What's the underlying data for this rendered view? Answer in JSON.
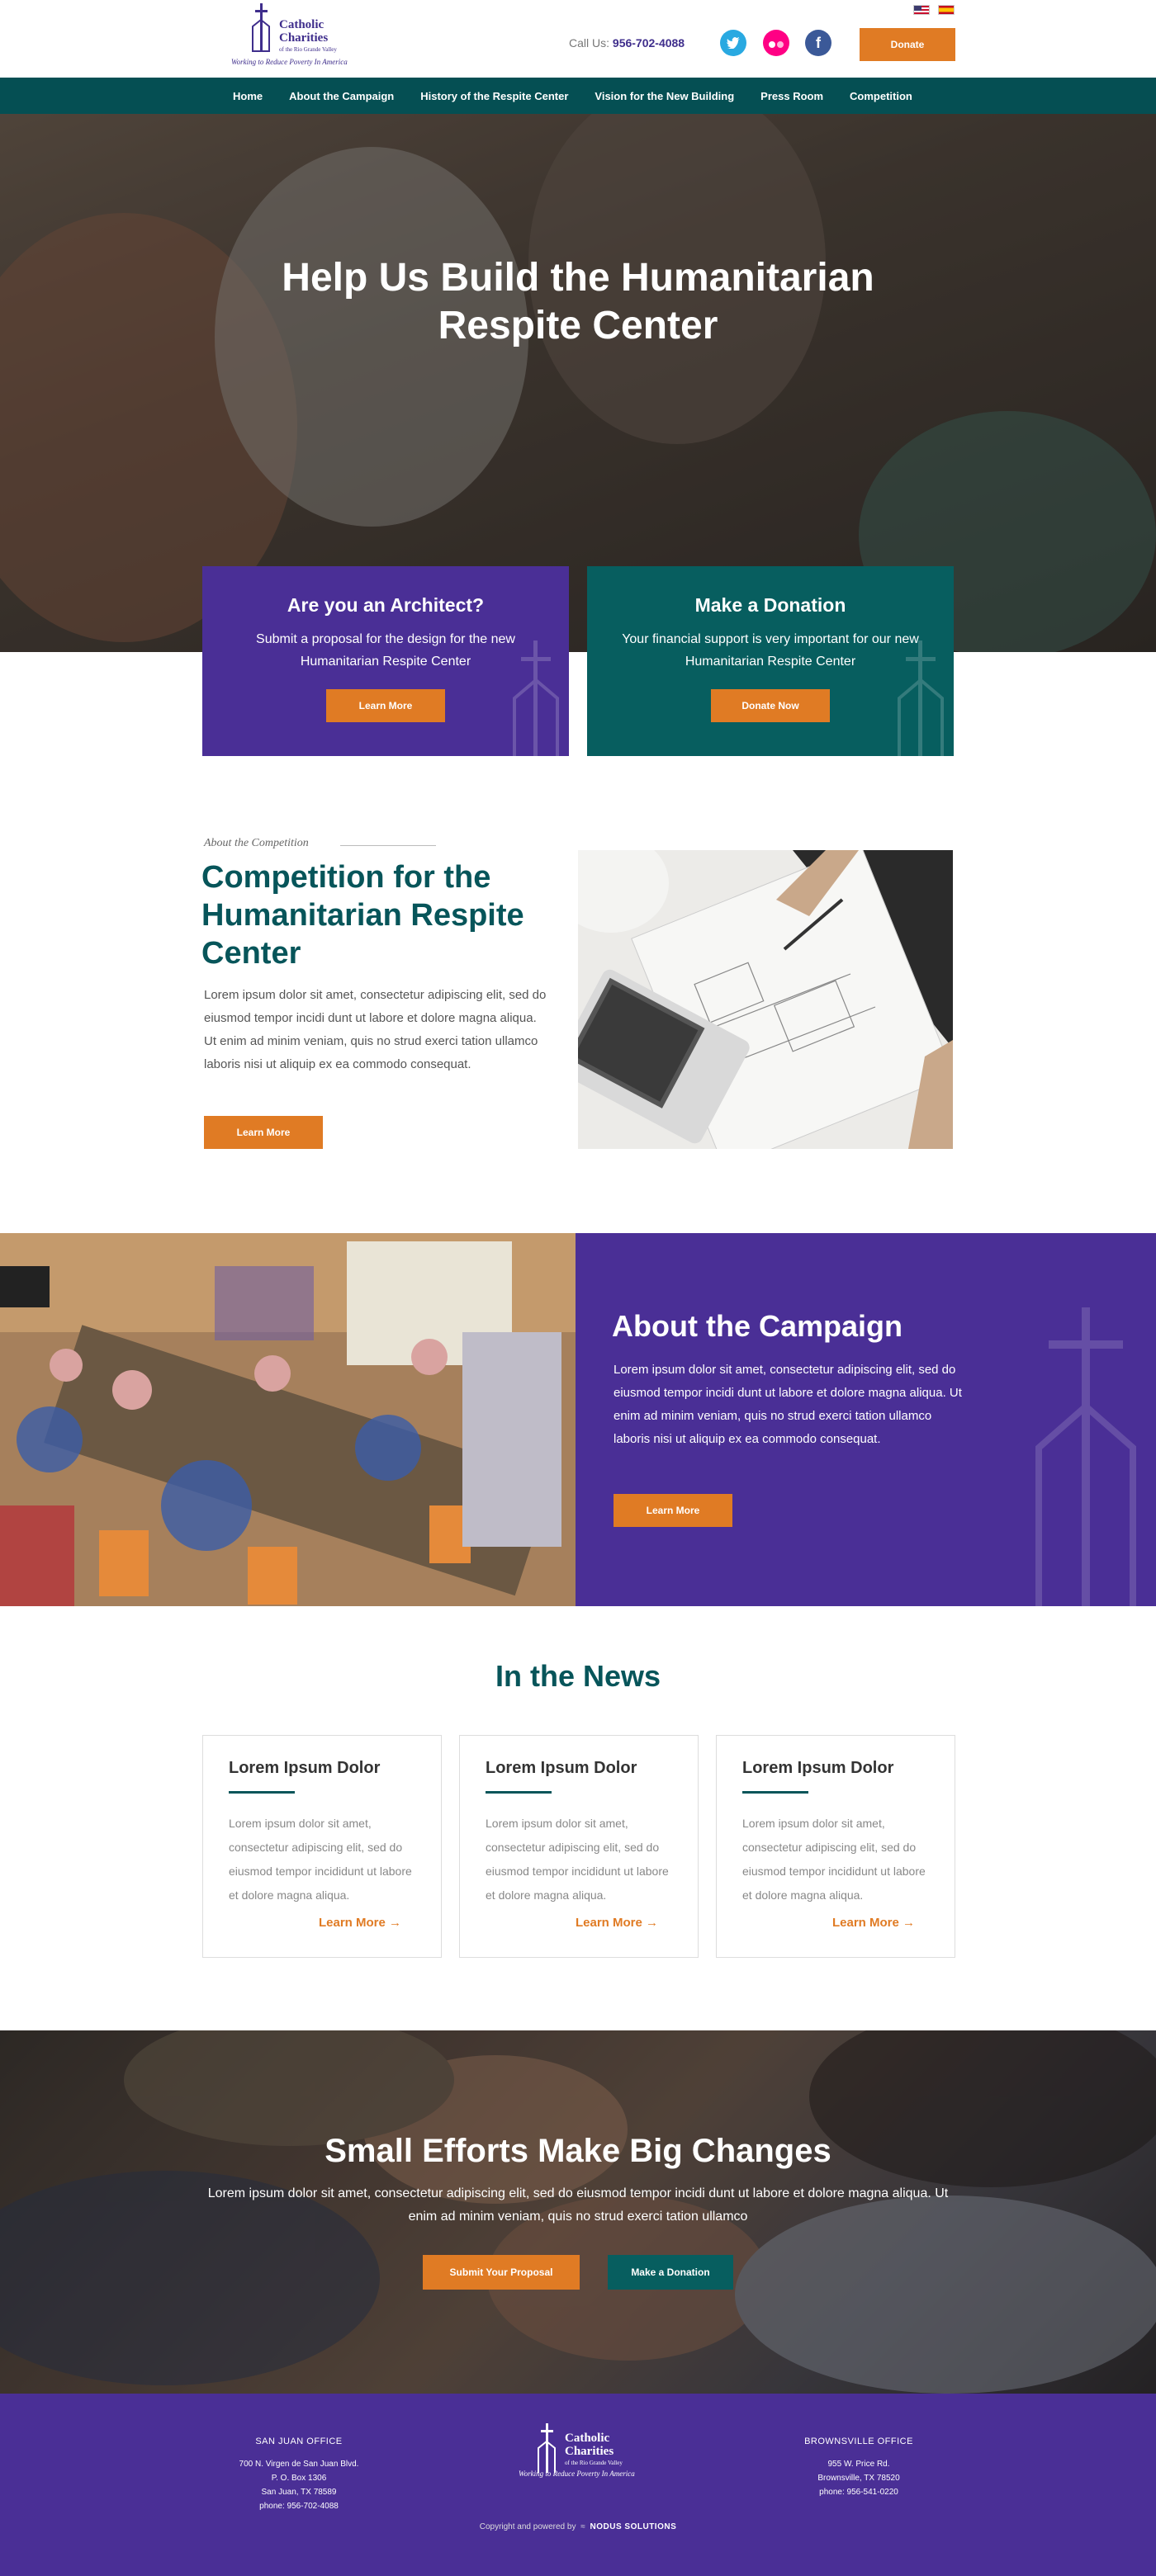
{
  "header": {
    "logo": {
      "line1": "Catholic",
      "line2": "Charities",
      "subtitle": "of the Rio Grande Valley",
      "tagline": "Working to Reduce Poverty In America"
    },
    "call_label": "Call Us:",
    "phone": "956-702-4088",
    "social": [
      {
        "icon": "twitter-icon"
      },
      {
        "icon": "flickr-icon"
      },
      {
        "icon": "facebook-icon"
      }
    ],
    "languages": [
      "us-flag-icon",
      "spain-flag-icon"
    ],
    "donate_label": "Donate"
  },
  "nav": {
    "items": [
      "Home",
      "About  the Campaign",
      "History of the Respite Center",
      "Vision for the New Building",
      "Press Room",
      "Competition"
    ]
  },
  "hero": {
    "title_line1": "Help Us Build the Humanitarian",
    "title_line2": "Respite Center",
    "cards": [
      {
        "title": "Are you an Architect?",
        "text": "Submit a proposal for the design for the new Humanitarian Respite Center",
        "button": "Learn More"
      },
      {
        "title": "Make a Donation",
        "text": "Your financial support is very important for our new Humanitarian Respite Center",
        "button": "Donate Now"
      }
    ]
  },
  "competition": {
    "eyebrow": "About the Competition",
    "title": "Competition for the Humanitarian Respite Center",
    "text": "Lorem ipsum dolor sit amet, consectetur adipiscing elit, sed do eiusmod tempor incidi dunt ut labore et dolore magna aliqua. Ut enim ad minim veniam, quis no strud exerci tation ullamco laboris nisi ut aliquip ex ea commodo consequat.",
    "button": "Learn More"
  },
  "campaign": {
    "title": "About the Campaign",
    "text": "Lorem ipsum dolor sit amet, consectetur adipiscing elit, sed do eiusmod tempor incidi dunt ut labore et dolore magna aliqua. Ut enim ad minim veniam, quis no strud exerci tation ullamco laboris nisi ut aliquip ex ea commodo consequat.",
    "button": "Learn More"
  },
  "news": {
    "title": "In the News",
    "items": [
      {
        "title": "Lorem Ipsum Dolor",
        "text": "Lorem ipsum dolor sit amet, consectetur adipiscing elit, sed do eiusmod tempor incididunt ut labore et dolore magna aliqua.",
        "link": "Learn More"
      },
      {
        "title": "Lorem Ipsum Dolor",
        "text": "Lorem ipsum dolor sit amet, consectetur adipiscing elit, sed do eiusmod tempor incididunt ut labore et dolore magna aliqua.",
        "link": "Learn More"
      },
      {
        "title": "Lorem Ipsum Dolor",
        "text": "Lorem ipsum dolor sit amet, consectetur adipiscing elit, sed do eiusmod tempor incididunt ut labore et dolore magna aliqua.",
        "link": "Learn More"
      }
    ]
  },
  "efforts": {
    "title": "Small Efforts Make Big Changes",
    "text": "Lorem ipsum dolor sit amet, consectetur adipiscing elit, sed do eiusmod tempor incidi dunt ut labore et dolore magna aliqua. Ut enim ad minim veniam, quis no strud exerci tation ullamco",
    "button_proposal": "Submit Your Proposal",
    "button_donation": "Make a Donation"
  },
  "footer": {
    "san_juan": {
      "heading": "SAN JUAN OFFICE",
      "lines": [
        "700 N. Virgen de San Juan Blvd.",
        "P. O. Box 1306",
        "San Juan, TX 78589",
        "phone: 956-702-4088"
      ]
    },
    "brownsville": {
      "heading": "BROWNSVILLE OFFICE",
      "lines": [
        "955 W. Price Rd.",
        "Brownsville, TX 78520",
        "phone: 956-541-0220"
      ]
    },
    "copyright": "Copyright and powered by",
    "powered_by": "NODUS SOLUTIONS"
  },
  "colors": {
    "purple": "#4a2f96",
    "teal": "#075e5f",
    "orange": "#e07b24"
  }
}
